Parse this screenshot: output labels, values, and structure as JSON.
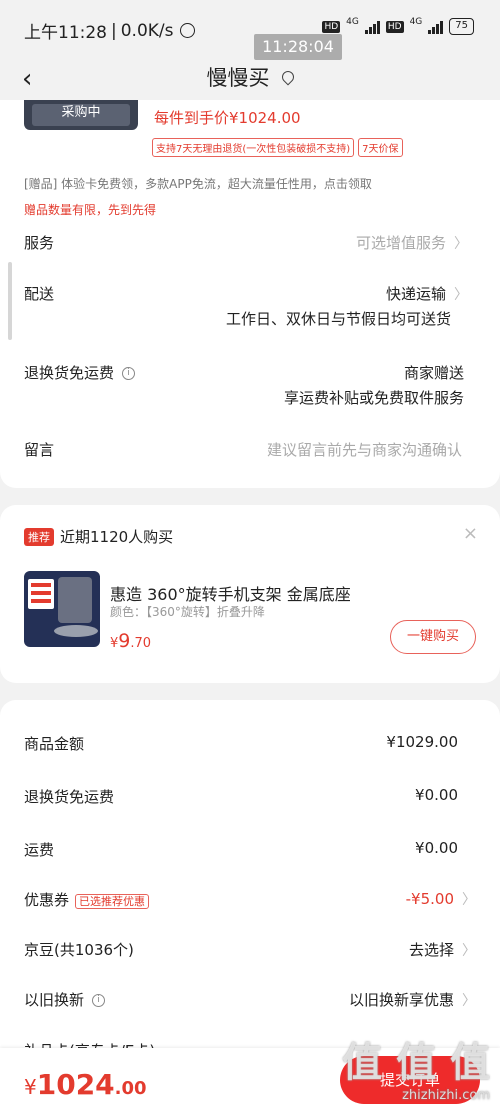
{
  "status_bar": {
    "time_text": "上午11:28",
    "net_speed": "0.0K/s",
    "signal1": "4G",
    "signal2": "4G",
    "hd1": "HD",
    "hd2": "HD",
    "battery": "75"
  },
  "time_overlay": "11:28:04",
  "nav": {
    "title": "慢慢买",
    "back_icon": "chevron-left-icon",
    "location_icon": "location-pin-icon"
  },
  "product": {
    "thumb_label": "采购中",
    "price_line": "每件到手价¥1024.00",
    "tags": [
      "支持7天无理由退货(一次性包装破损不支持)",
      "7天价保"
    ],
    "gift": "[赠品]  体验卡免费领，多款APP免流，超大流量任性用，点击领取",
    "gift_warning": "赠品数量有限，先到先得"
  },
  "service": {
    "label": "服务",
    "value": "可选增值服务"
  },
  "delivery": {
    "label": "配送",
    "value": "快递运输",
    "sub": "工作日、双休日与节假日均可送货"
  },
  "return_freight": {
    "label": "退换货免运费",
    "value": "商家赠送",
    "sub": "享运费补贴或免费取件服务"
  },
  "message": {
    "label": "留言",
    "placeholder": "建议留言前先与商家沟通确认"
  },
  "recommend": {
    "badge": "推荐",
    "title": "近期1120人购买",
    "close": "×",
    "product_name": "惠造 360°旋转手机支架 金属底座",
    "product_color": "颜色：【360°旋转】折叠升降",
    "price_symbol": "¥",
    "price_int": "9",
    "price_dec": ".70",
    "buy_label": "一键购买"
  },
  "summary": {
    "goods_amount_label": "商品金额",
    "goods_amount": "¥1029.00",
    "return_freight_label": "退换货免运费",
    "return_freight": "¥0.00",
    "shipping_label": "运费",
    "shipping": "¥0.00",
    "coupon_label": "优惠券",
    "coupon_tag": "已选推荐优惠",
    "coupon_value": "-¥5.00",
    "jingdou_label": "京豆(共1036个)",
    "jingdou_value": "去选择",
    "tradein_label": "以旧换新",
    "tradein_value": "以旧换新享优惠",
    "cut_label": "礼品卡(高专卡/E卡)"
  },
  "bottom": {
    "currency": "¥",
    "total_int": "1024",
    "total_dec": ".00",
    "submit_label": "提交订单"
  },
  "watermark": {
    "big": "值 值 值",
    "small": "zhizhizhi.com"
  },
  "colors": {
    "accent": "#e33b2e",
    "submit": "#ee2b2b",
    "background": "#f2f2f2"
  }
}
